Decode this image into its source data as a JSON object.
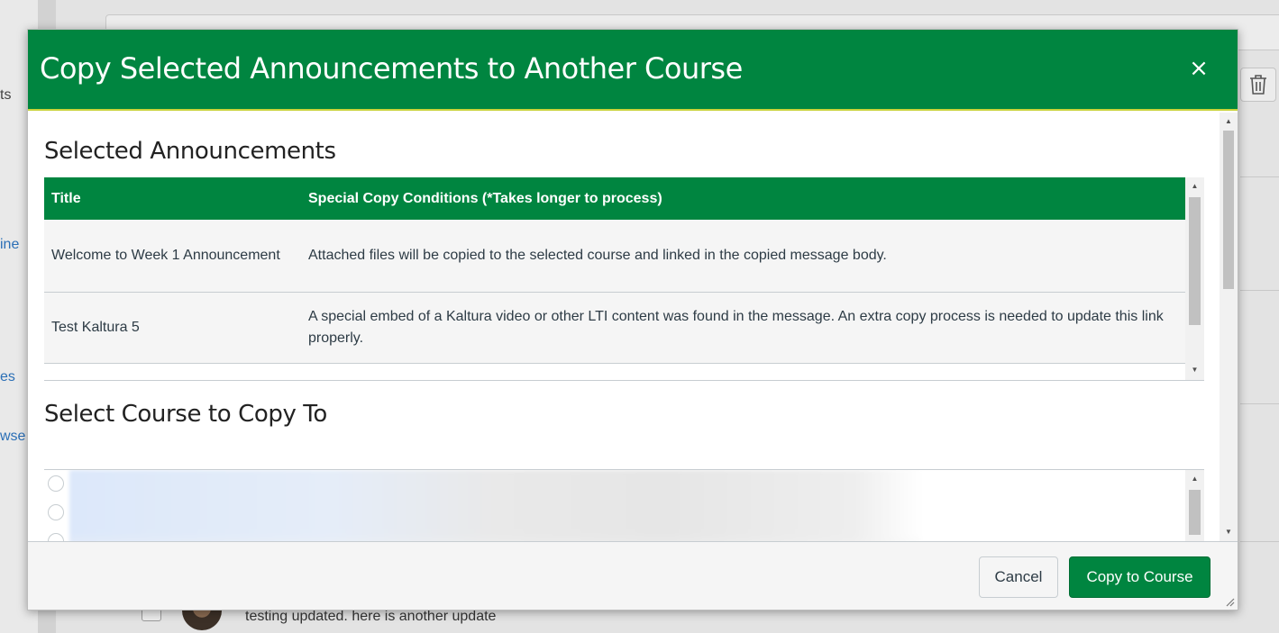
{
  "background": {
    "nav_fragments": [
      "ts",
      "ine",
      "es",
      "wse"
    ],
    "post_text": "testing updated. here is another update"
  },
  "modal": {
    "title": "Copy Selected Announcements to Another Course",
    "close_symbol": "×",
    "selected_section": {
      "heading": "Selected Announcements",
      "columns": [
        "Title",
        "Special Copy Conditions (*Takes longer to process)"
      ],
      "rows": [
        {
          "title": "Welcome to Week 1 Announcement",
          "condition": "Attached files will be copied to the selected course and linked in the copied message body."
        },
        {
          "title": "Test Kaltura 5",
          "condition": "A special embed of a Kaltura video or other LTI content was found in the message. An extra copy process is needed to update this link properly."
        }
      ]
    },
    "course_section": {
      "heading": "Select Course to Copy To"
    },
    "footer": {
      "cancel_label": "Cancel",
      "copy_label": "Copy to Course"
    }
  },
  "colors": {
    "brand_green": "#008540",
    "header_accent": "#c9d33a",
    "link_blue": "#2b6fb6"
  },
  "icons": {
    "background_trash": "trash-icon",
    "close": "close-icon",
    "scroll_up": "chevron-up-icon",
    "scroll_down": "chevron-down-icon",
    "resize": "resize-grip-icon"
  }
}
